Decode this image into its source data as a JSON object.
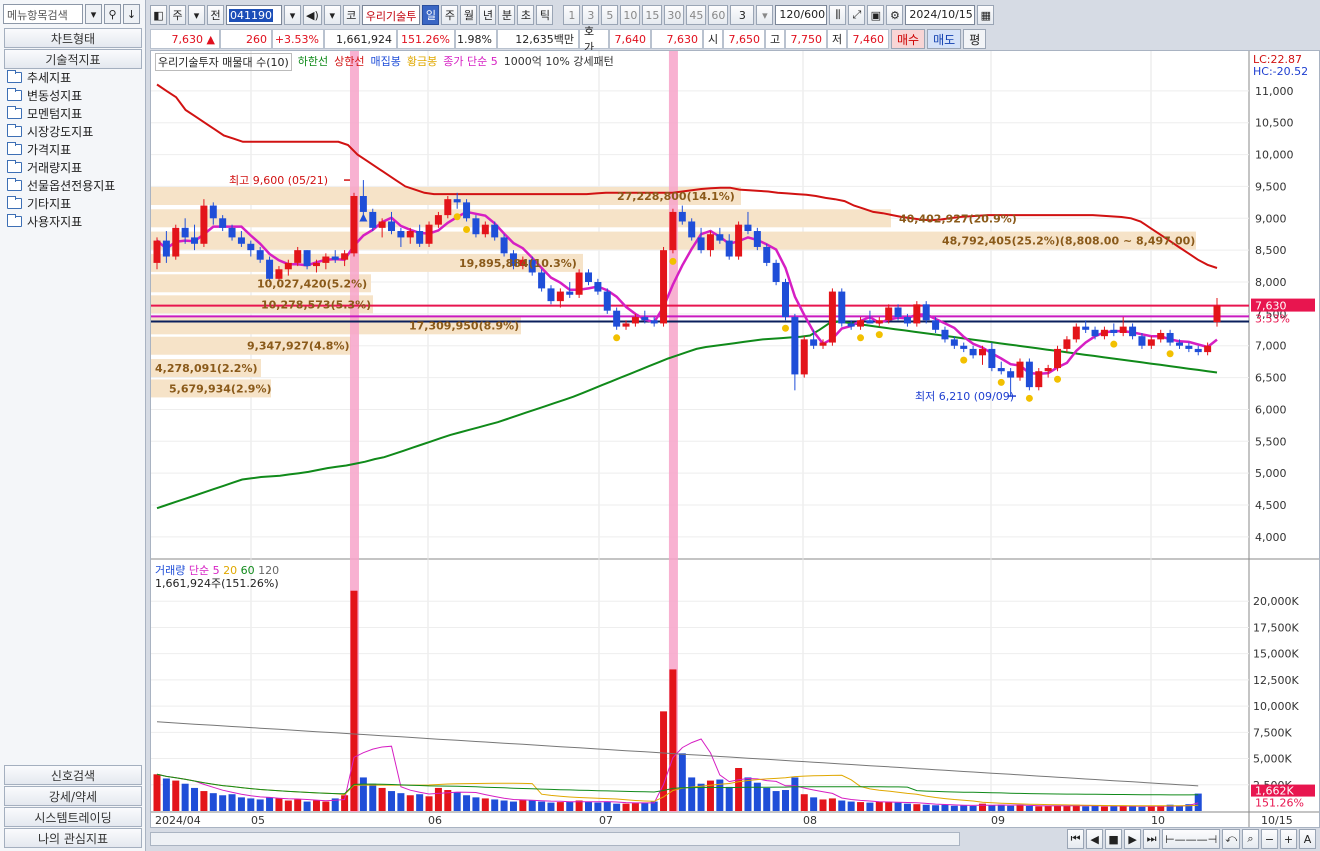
{
  "left": {
    "search_placeholder": "메뉴항목검색",
    "head_chart_type": "차트형태",
    "head_indicators": "기술적지표",
    "tree": [
      "추세지표",
      "변동성지표",
      "모멘텀지표",
      "시장강도지표",
      "가격지표",
      "거래량지표",
      "선물옵션전용지표",
      "기타지표",
      "사용자지표"
    ],
    "bottom": [
      "신호검색",
      "강세/약세",
      "시스템트레이딩",
      "나의 관심지표"
    ]
  },
  "toolbar": {
    "stock_type": "주",
    "prev": "전",
    "code": "041190",
    "market": "코",
    "name": "우리기술투",
    "periods": [
      "일",
      "주",
      "월",
      "년",
      "분",
      "초",
      "틱"
    ],
    "active_period": "일",
    "intervals": [
      "1",
      "3",
      "5",
      "10",
      "15",
      "30",
      "45",
      "60"
    ],
    "interval_value": "3",
    "count": "120/600",
    "date": "2024/10/15"
  },
  "pricebar": {
    "price": "7,630",
    "arrow": "▲",
    "change": "260",
    "change_pct": "+3.53%",
    "volume": "1,661,924",
    "volume_ratio": "151.26%",
    "turnover": "1.98%",
    "amount": "12,635백만",
    "ask_label": "호가",
    "ask1": "7,640",
    "ask2": "7,630",
    "open_label": "시",
    "open": "7,650",
    "high_label": "고",
    "high": "7,750",
    "low_label": "저",
    "low": "7,460",
    "buy": "매수",
    "sell": "매도",
    "eval": "평"
  },
  "legend": {
    "main": "우리기술투자 매물대 수(10)",
    "lower_band": "하한선",
    "upper_band": "상한선",
    "cluster": "매집봉",
    "golden": "황금봉",
    "close_sma": "종가 단순 5",
    "pattern": "1000억 10% 강세패턴",
    "vol_title": "거래량",
    "vol_sma": "단순 5",
    "vol_20": "20",
    "vol_60": "60",
    "vol_120": "120",
    "vol_value": "1,661,924주(151.26%)"
  },
  "annotations": {
    "high": "최고 9,600 (05/21)",
    "low": "최저 6,210 (09/09)",
    "lc": "LC:22.87",
    "hc": "HC:-20.52",
    "price_tag": "7,630",
    "pct_tag": "3.53%",
    "vol_tag": "1,662K",
    "vol_pct_tag": "151.26%",
    "profile": [
      {
        "label": "27,228,800(14.1%)",
        "price": 9350
      },
      {
        "label": "40,402,927(20.9%)",
        "price": 9000
      },
      {
        "label": "48,792,405(25.2%)(8,808.00 ~ 8,497.00)",
        "price": 8650
      },
      {
        "label": "19,895,884(10.3%)",
        "price": 8300
      },
      {
        "label": "10,027,420(5.2%)",
        "price": 7980
      },
      {
        "label": "10,278,573(5.3%)",
        "price": 7650
      },
      {
        "label": "17,309,950(8.9%)",
        "price": 7320
      },
      {
        "label": "9,347,927(4.8%)",
        "price": 7000
      },
      {
        "label": "4,278,091(2.2%)",
        "price": 6650
      },
      {
        "label": "5,679,934(2.9%)",
        "price": 6330
      }
    ]
  },
  "chart_data": {
    "type": "candlestick",
    "price_axis": [
      "11,000",
      "10,500",
      "10,000",
      "9,500",
      "9,000",
      "8,500",
      "8,000",
      "7,500",
      "7,000",
      "6,500",
      "6,000",
      "5,500",
      "5,000",
      "4,500",
      "4,000"
    ],
    "volume_axis": [
      "20,000K",
      "17,500K",
      "15,000K",
      "12,500K",
      "10,000K",
      "7,500K",
      "5,000K",
      "2,500K"
    ],
    "x_labels": [
      "2024/04",
      "05",
      "06",
      "07",
      "08",
      "09",
      "10",
      "10/15"
    ],
    "candles": [
      [
        8300,
        8700,
        8200,
        8650
      ],
      [
        8650,
        8800,
        8300,
        8400
      ],
      [
        8400,
        8900,
        8350,
        8850
      ],
      [
        8850,
        9000,
        8600,
        8700
      ],
      [
        8700,
        8900,
        8500,
        8600
      ],
      [
        8600,
        9300,
        8550,
        9200
      ],
      [
        9200,
        9250,
        8900,
        9000
      ],
      [
        9000,
        9050,
        8800,
        8850
      ],
      [
        8850,
        8900,
        8650,
        8700
      ],
      [
        8700,
        8800,
        8550,
        8600
      ],
      [
        8600,
        8650,
        8400,
        8500
      ],
      [
        8500,
        8550,
        8300,
        8350
      ],
      [
        8350,
        8400,
        8000,
        8050
      ],
      [
        8050,
        8250,
        8000,
        8200
      ],
      [
        8200,
        8350,
        8100,
        8300
      ],
      [
        8300,
        8550,
        8250,
        8500
      ],
      [
        8500,
        8500,
        8200,
        8250
      ],
      [
        8250,
        8350,
        8150,
        8300
      ],
      [
        8300,
        8450,
        8200,
        8400
      ],
      [
        8400,
        8500,
        8300,
        8350
      ],
      [
        8350,
        8500,
        8250,
        8450
      ],
      [
        8450,
        9400,
        8400,
        9350
      ],
      [
        9350,
        9600,
        9000,
        9100
      ],
      [
        9100,
        9150,
        8800,
        8850
      ],
      [
        8850,
        9000,
        8700,
        8950
      ],
      [
        8950,
        9100,
        8750,
        8800
      ],
      [
        8800,
        8850,
        8550,
        8700
      ],
      [
        8700,
        8850,
        8600,
        8800
      ],
      [
        8800,
        8900,
        8550,
        8600
      ],
      [
        8600,
        8950,
        8550,
        8900
      ],
      [
        8900,
        9100,
        8850,
        9050
      ],
      [
        9050,
        9350,
        9000,
        9300
      ],
      [
        9300,
        9400,
        9150,
        9250
      ],
      [
        9250,
        9300,
        8950,
        9000
      ],
      [
        9000,
        9050,
        8700,
        8750
      ],
      [
        8750,
        8950,
        8700,
        8900
      ],
      [
        8900,
        8950,
        8650,
        8700
      ],
      [
        8700,
        8750,
        8400,
        8450
      ],
      [
        8450,
        8500,
        8200,
        8250
      ],
      [
        8250,
        8400,
        8200,
        8350
      ],
      [
        8350,
        8400,
        8100,
        8150
      ],
      [
        8150,
        8200,
        7850,
        7900
      ],
      [
        7900,
        7950,
        7650,
        7700
      ],
      [
        7700,
        7900,
        7600,
        7850
      ],
      [
        7850,
        8000,
        7750,
        7800
      ],
      [
        7800,
        8200,
        7750,
        8150
      ],
      [
        8150,
        8200,
        7950,
        8000
      ],
      [
        8000,
        8050,
        7800,
        7850
      ],
      [
        7850,
        7900,
        7500,
        7550
      ],
      [
        7550,
        7600,
        7250,
        7300
      ],
      [
        7300,
        7400,
        7250,
        7350
      ],
      [
        7350,
        7500,
        7300,
        7450
      ],
      [
        7450,
        7550,
        7350,
        7400
      ],
      [
        7400,
        7450,
        7300,
        7350
      ],
      [
        7350,
        8550,
        7300,
        8500
      ],
      [
        8500,
        9150,
        8450,
        9100
      ],
      [
        9100,
        9200,
        8900,
        8950
      ],
      [
        8950,
        9000,
        8650,
        8700
      ],
      [
        8700,
        8850,
        8450,
        8500
      ],
      [
        8500,
        8800,
        8400,
        8750
      ],
      [
        8750,
        8850,
        8600,
        8650
      ],
      [
        8650,
        8750,
        8350,
        8400
      ],
      [
        8400,
        8950,
        8350,
        8900
      ],
      [
        8900,
        9100,
        8750,
        8800
      ],
      [
        8800,
        8850,
        8500,
        8550
      ],
      [
        8550,
        8600,
        8250,
        8300
      ],
      [
        8300,
        8350,
        7950,
        8000
      ],
      [
        8000,
        8050,
        7400,
        7450
      ],
      [
        7450,
        7500,
        6300,
        6550
      ],
      [
        6550,
        7150,
        6500,
        7100
      ],
      [
        7100,
        7250,
        6950,
        7000
      ],
      [
        7000,
        7100,
        6950,
        7050
      ],
      [
        7050,
        7900,
        7000,
        7850
      ],
      [
        7850,
        7900,
        7300,
        7350
      ],
      [
        7350,
        7400,
        7250,
        7300
      ],
      [
        7300,
        7450,
        7250,
        7400
      ],
      [
        7400,
        7550,
        7350,
        7350
      ],
      [
        7350,
        7450,
        7300,
        7400
      ],
      [
        7400,
        7650,
        7350,
        7600
      ],
      [
        7600,
        7650,
        7400,
        7450
      ],
      [
        7450,
        7500,
        7300,
        7350
      ],
      [
        7350,
        7700,
        7300,
        7650
      ],
      [
        7650,
        7700,
        7350,
        7400
      ],
      [
        7400,
        7450,
        7200,
        7250
      ],
      [
        7250,
        7300,
        7050,
        7100
      ],
      [
        7100,
        7150,
        6950,
        7000
      ],
      [
        7000,
        7050,
        6900,
        6950
      ],
      [
        6950,
        7000,
        6800,
        6850
      ],
      [
        6850,
        7000,
        6700,
        6950
      ],
      [
        6950,
        7050,
        6600,
        6650
      ],
      [
        6650,
        6750,
        6550,
        6600
      ],
      [
        6600,
        6650,
        6210,
        6500
      ],
      [
        6500,
        6800,
        6450,
        6750
      ],
      [
        6750,
        6800,
        6300,
        6350
      ],
      [
        6350,
        6650,
        6300,
        6600
      ],
      [
        6600,
        6700,
        6500,
        6650
      ],
      [
        6650,
        7000,
        6600,
        6950
      ],
      [
        6950,
        7150,
        6900,
        7100
      ],
      [
        7100,
        7350,
        7050,
        7300
      ],
      [
        7300,
        7400,
        7200,
        7250
      ],
      [
        7250,
        7300,
        7100,
        7150
      ],
      [
        7150,
        7300,
        7100,
        7250
      ],
      [
        7250,
        7350,
        7150,
        7200
      ],
      [
        7200,
        7450,
        7150,
        7300
      ],
      [
        7300,
        7350,
        7100,
        7150
      ],
      [
        7150,
        7200,
        6950,
        7000
      ],
      [
        7000,
        7150,
        6950,
        7100
      ],
      [
        7100,
        7250,
        7050,
        7200
      ],
      [
        7200,
        7250,
        7000,
        7050
      ],
      [
        7050,
        7100,
        6950,
        7000
      ],
      [
        7000,
        7050,
        6900,
        6950
      ],
      [
        6950,
        7000,
        6850,
        6900
      ],
      [
        6900,
        7050,
        6850,
        7000
      ],
      [
        7370,
        7750,
        7300,
        7630
      ]
    ],
    "volume_k": [
      3500,
      3100,
      2900,
      2600,
      2200,
      1900,
      1700,
      1500,
      1600,
      1300,
      1200,
      1100,
      1300,
      1200,
      1000,
      1100,
      900,
      1000,
      900,
      1200,
      1500,
      21000,
      3200,
      2600,
      2200,
      1900,
      1700,
      1500,
      1600,
      1400,
      2200,
      2000,
      1800,
      1500,
      1300,
      1200,
      1100,
      1000,
      900,
      1100,
      1000,
      900,
      800,
      850,
      900,
      1000,
      900,
      800,
      900,
      700,
      700,
      750,
      800,
      900,
      9500,
      13500,
      5500,
      3200,
      2600,
      2900,
      3000,
      2300,
      4100,
      3200,
      2700,
      2200,
      1900,
      2000,
      3200,
      1600,
      1300,
      1100,
      1200,
      1000,
      900,
      850,
      800,
      900,
      850,
      800,
      700,
      650,
      600,
      550,
      600,
      500,
      520,
      480,
      700,
      550,
      600,
      500,
      520,
      480,
      450,
      500,
      520,
      480,
      600,
      450,
      500,
      420,
      450,
      500,
      480,
      400,
      420,
      450,
      600,
      500,
      650,
      1662
    ]
  },
  "colors": {
    "up": "#e3141a",
    "down": "#1f4ed8",
    "upper_band": "#d11212",
    "lower_band": "#108a1a",
    "sma": "#d61fc3",
    "golden": "#f2c000",
    "pattern": "#f7a3c9",
    "profile": "#f6e3c8"
  }
}
